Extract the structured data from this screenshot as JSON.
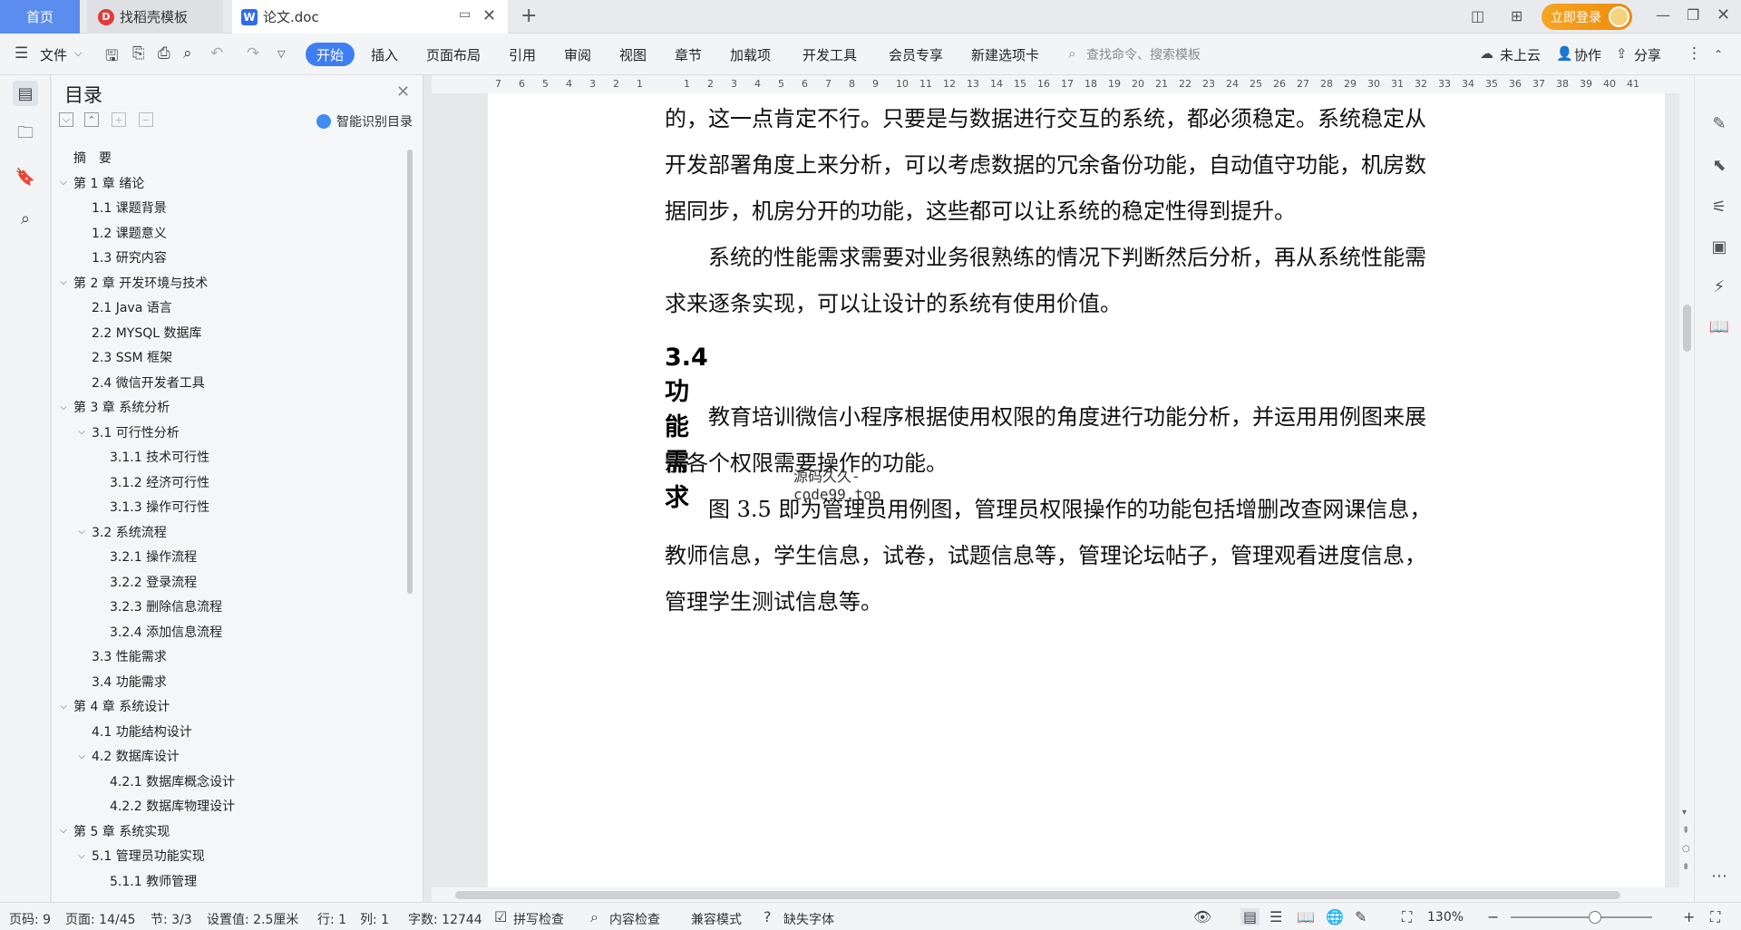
{
  "tabs": {
    "home": "首页",
    "template": "找稻壳模板",
    "doc": "论文.doc"
  },
  "login": "立即登录",
  "ribbon": {
    "file": "文件",
    "start": "开始",
    "items": [
      "插入",
      "页面布局",
      "引用",
      "审阅",
      "视图",
      "章节",
      "加载项",
      "开发工具",
      "会员专享",
      "新建选项卡"
    ],
    "search_placeholder": "查找命令、搜索模板",
    "cloud": "未上云",
    "collab": "协作",
    "share": "分享"
  },
  "ruler": [
    "7",
    "6",
    "5",
    "4",
    "3",
    "2",
    "1",
    "",
    "1",
    "2",
    "3",
    "4",
    "5",
    "6",
    "7",
    "8",
    "9",
    "10",
    "11",
    "12",
    "13",
    "14",
    "15",
    "16",
    "17",
    "18",
    "19",
    "20",
    "21",
    "22",
    "23",
    "24",
    "25",
    "26",
    "27",
    "28",
    "29",
    "30",
    "31",
    "32",
    "33",
    "34",
    "35",
    "36",
    "37",
    "38",
    "39",
    "40",
    "41"
  ],
  "toc": {
    "title": "目录",
    "smart": "智能识别目录",
    "items": [
      {
        "text": "摘　要",
        "level": 0,
        "chev": ""
      },
      {
        "text": "第 1 章  绪论",
        "level": 0,
        "chev": "⌵"
      },
      {
        "text": "1.1  课题背景",
        "level": 1,
        "chev": ""
      },
      {
        "text": "1.2  课题意义",
        "level": 1,
        "chev": ""
      },
      {
        "text": "1.3  研究内容",
        "level": 1,
        "chev": ""
      },
      {
        "text": "第 2 章  开发环境与技术",
        "level": 0,
        "chev": "⌵"
      },
      {
        "text": "2.1 Java 语言",
        "level": 1,
        "chev": ""
      },
      {
        "text": "2.2 MYSQL 数据库",
        "level": 1,
        "chev": ""
      },
      {
        "text": "2.3 SSM 框架",
        "level": 1,
        "chev": ""
      },
      {
        "text": "2.4 微信开发者工具",
        "level": 1,
        "chev": ""
      },
      {
        "text": "第 3 章  系统分析",
        "level": 0,
        "chev": "⌵"
      },
      {
        "text": "3.1  可行性分析",
        "level": 1,
        "chev": "⌵"
      },
      {
        "text": "3.1.1  技术可行性",
        "level": 2,
        "chev": ""
      },
      {
        "text": "3.1.2  经济可行性",
        "level": 2,
        "chev": ""
      },
      {
        "text": "3.1.3  操作可行性",
        "level": 2,
        "chev": ""
      },
      {
        "text": "3.2  系统流程",
        "level": 1,
        "chev": "⌵"
      },
      {
        "text": "3.2.1  操作流程",
        "level": 2,
        "chev": ""
      },
      {
        "text": "3.2.2  登录流程",
        "level": 2,
        "chev": ""
      },
      {
        "text": "3.2.3  删除信息流程",
        "level": 2,
        "chev": ""
      },
      {
        "text": "3.2.4  添加信息流程",
        "level": 2,
        "chev": ""
      },
      {
        "text": "3.3  性能需求",
        "level": 1,
        "chev": ""
      },
      {
        "text": "3.4  功能需求",
        "level": 1,
        "chev": ""
      },
      {
        "text": "第 4 章  系统设计",
        "level": 0,
        "chev": "⌵"
      },
      {
        "text": "4.1  功能结构设计",
        "level": 1,
        "chev": ""
      },
      {
        "text": "4.2  数据库设计",
        "level": 1,
        "chev": "⌵"
      },
      {
        "text": "4.2.1  数据库概念设计",
        "level": 2,
        "chev": ""
      },
      {
        "text": "4.2.2  数据库物理设计",
        "level": 2,
        "chev": ""
      },
      {
        "text": "第 5 章  系统实现",
        "level": 0,
        "chev": "⌵"
      },
      {
        "text": "5.1  管理员功能实现",
        "level": 1,
        "chev": "⌵"
      },
      {
        "text": "5.1.1  教师管理",
        "level": 2,
        "chev": ""
      }
    ]
  },
  "doc": {
    "lines": [
      "的，这一点肯定不行。只要是与数据进行交互的系统，都必须稳定。系统稳定从",
      "开发部署角度上来分析，可以考虑数据的冗余备份功能，自动值守功能，机房数",
      "据同步，机房分开的功能，这些都可以让系统的稳定性得到提升。",
      "　　系统的性能需求需要对业务很熟练的情况下判断然后分析，再从系统性能需",
      "求来逐条实现，可以让设计的系统有使用价值。"
    ],
    "heading": "3.4  功能需求",
    "lines2": [
      "　　教育培训微信小程序根据使用权限的角度进行功能分析，并运用用例图来展",
      "示各个权限需要操作的功能。",
      "　　图 3.5 即为管理员用例图，管理员权限操作的功能包括增删改查网课信息，",
      "教师信息，学生信息，试卷，试题信息等，管理论坛帖子，管理观看进度信息，",
      "管理学生测试信息等。"
    ],
    "watermark": "源码久久-code99.top"
  },
  "status": {
    "page_no": "页码: 9",
    "page": "页面: 14/45",
    "section": "节: 3/3",
    "setting": "设置值: 2.5厘米",
    "row": "行: 1",
    "col": "列: 1",
    "words": "字数: 12744",
    "spell": "拼写检查",
    "content_check": "内容检查",
    "compat": "兼容模式",
    "missing_font": "缺失字体",
    "zoom": "130%"
  }
}
